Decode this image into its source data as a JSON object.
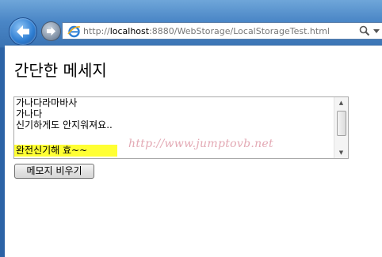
{
  "browser": {
    "url_prefix": "http://",
    "url_host": "localhost",
    "url_rest": ":8880/WebStorage/LocalStorageTest.html"
  },
  "page": {
    "title": "간단한 메세지",
    "memo_lines": [
      "가나다라마바사",
      "가나다",
      "신기하게도 안지워져요.."
    ],
    "highlighted_line": "완전신기해 효~~",
    "highlight_color": "#ffff33",
    "clear_button_label": "메모지 비우기",
    "watermark": "http://www.jumptovb.net"
  }
}
